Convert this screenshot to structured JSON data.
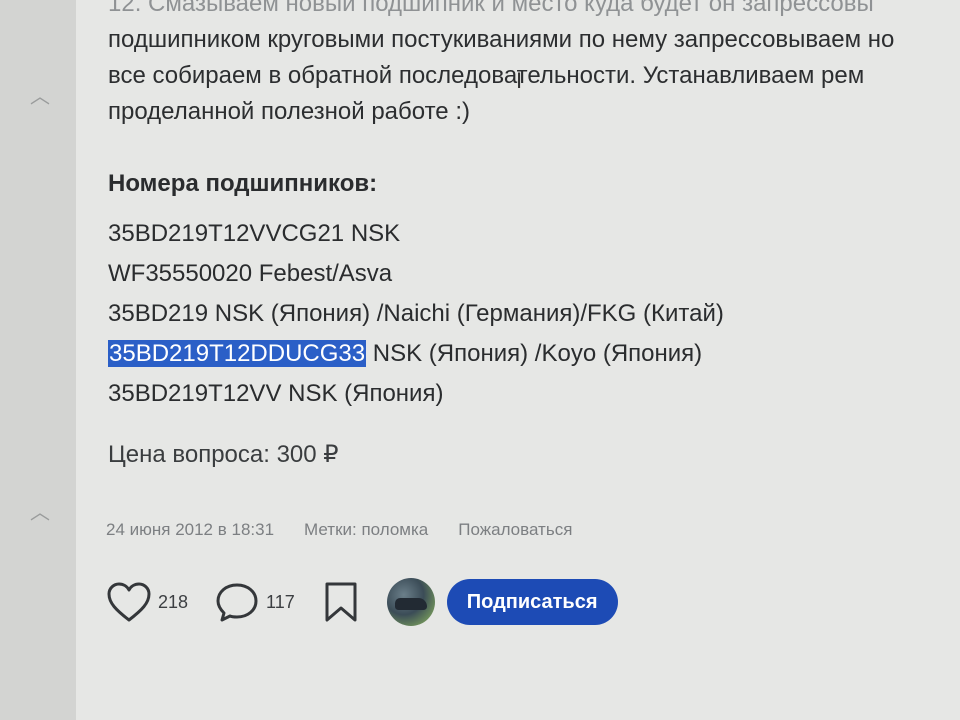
{
  "article": {
    "lines": [
      "12. Смазываем новый подшипник и место куда будет он запрессовы",
      "подшипником круговыми постукиваниями по нему запрессовываем но",
      "все собираем в обратной последовательности. Устанавливаем рем",
      "проделанной полезной работе :)"
    ]
  },
  "bearings": {
    "title": "Номера подшипников:",
    "items": [
      {
        "code": "35BD219T12VVCG21 NSK",
        "rest": ""
      },
      {
        "code": "WF35550020 Febest/Asva",
        "rest": ""
      },
      {
        "code": "35BD219 NSK (Япония) /Naichi (Германия)/FKG (Китай)",
        "rest": ""
      },
      {
        "code": "35BD219T12DDUCG33",
        "rest": " NSK (Япония) /Koyo (Япония)"
      },
      {
        "code": "35BD219T12VV NSK (Япония)",
        "rest": ""
      }
    ]
  },
  "price": "Цена вопроса: 300 ₽",
  "meta": {
    "date": "24 июня 2012 в 18:31",
    "tags": "Метки: поломка",
    "report": "Пожаловаться"
  },
  "actions": {
    "likes": "218",
    "comments": "117",
    "subscribe_label": "Подписаться"
  },
  "icons": {
    "rail_up_1": "chevron-up-icon",
    "rail_up_2": "chevron-up-icon",
    "like": "heart-icon",
    "comment": "comment-icon",
    "bookmark": "bookmark-icon"
  },
  "colors": {
    "selection": "#2b5fc7",
    "subscribe": "#1d4bb5"
  }
}
